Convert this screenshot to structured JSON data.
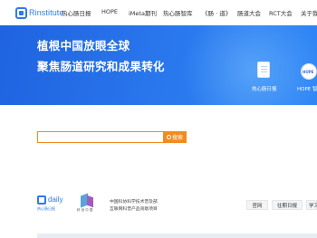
{
  "header": {
    "logo_text": "Rinstitute",
    "nav": [
      {
        "label": "热心肠日报"
      },
      {
        "label": "HOPE"
      },
      {
        "label": "iMeta期刊"
      },
      {
        "label": "热心肠智库"
      },
      {
        "label": "《肠 · 道》"
      },
      {
        "label": "肠道大会"
      },
      {
        "label": "RCT大会"
      },
      {
        "label": "关于我"
      }
    ]
  },
  "hero": {
    "line1": "植根中国放眼全球",
    "line2": "聚焦肠道研究和成果转化",
    "cards": [
      {
        "caption": "热心肠日报",
        "icon": "document-icon"
      },
      {
        "caption": "HOPE 智",
        "badge": "HOPE",
        "icon": "hope-logo-icon"
      }
    ]
  },
  "search": {
    "placeholder": "",
    "button_label": "搜索"
  },
  "daily": {
    "logo_text": "daily",
    "logo_sub": "热心肠日报",
    "partner_logo_text": "科 创 中 国",
    "partner_desc_lines": [
      "中国科协科学技术普及部",
      "互联网科普产品资助项目"
    ],
    "links": [
      {
        "label": "官网"
      },
      {
        "label": "往期日报"
      },
      {
        "label": "学习"
      }
    ]
  },
  "colors": {
    "brand_blue": "#2f7be6",
    "hero_blue": "#2a78ee",
    "search_orange": "#f08c1e"
  }
}
